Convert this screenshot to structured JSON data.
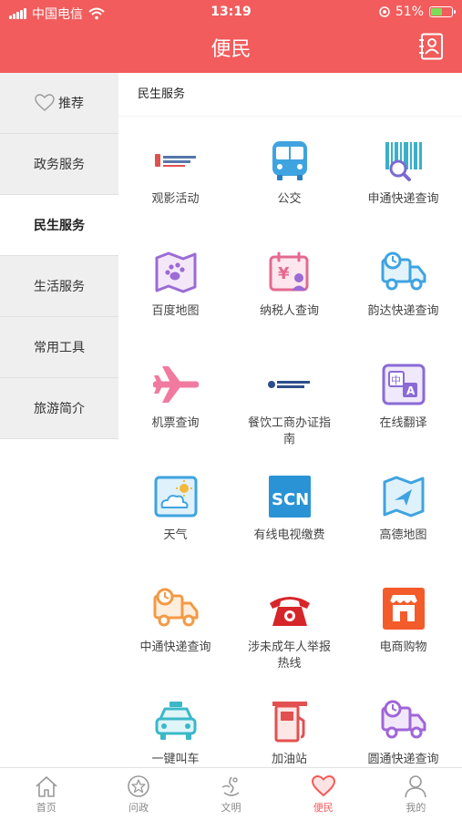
{
  "status_bar": {
    "carrier": "中国电信",
    "time": "13:19",
    "battery": "51%"
  },
  "header": {
    "title": "便民",
    "contacts_icon": "contacts-icon"
  },
  "sidebar": {
    "items": [
      {
        "label": "推荐",
        "icon": "heart-outline-icon"
      },
      {
        "label": "政务服务"
      },
      {
        "label": "民生服务",
        "active": true
      },
      {
        "label": "生活服务"
      },
      {
        "label": "常用工具"
      },
      {
        "label": "旅游简介"
      }
    ]
  },
  "main": {
    "section_title": "民生服务",
    "tiles": [
      {
        "label": "观影活动",
        "icon": "movie-logo-icon"
      },
      {
        "label": "公交",
        "icon": "bus-icon"
      },
      {
        "label": "申通快递查询",
        "icon": "barcode-search-icon"
      },
      {
        "label": "百度地图",
        "icon": "paw-map-icon"
      },
      {
        "label": "纳税人查询",
        "icon": "tax-calendar-icon"
      },
      {
        "label": "韵达快递查询",
        "icon": "delivery-truck-icon"
      },
      {
        "label": "机票查询",
        "icon": "airplane-icon"
      },
      {
        "label": "餐饮工商办证指南",
        "icon": "logo-icon"
      },
      {
        "label": "在线翻译",
        "icon": "translate-icon"
      },
      {
        "label": "天气",
        "icon": "weather-icon"
      },
      {
        "label": "有线电视缴费",
        "icon": "scn-logo-icon"
      },
      {
        "label": "高德地图",
        "icon": "map-navigation-icon"
      },
      {
        "label": "中通快递查询",
        "icon": "delivery-truck-icon"
      },
      {
        "label": "涉未成年人举报热线",
        "icon": "telephone-icon"
      },
      {
        "label": "电商购物",
        "icon": "shop-icon"
      },
      {
        "label": "一键叫车",
        "icon": "taxi-icon"
      },
      {
        "label": "加油站",
        "icon": "gas-station-icon"
      },
      {
        "label": "圆通快递查询",
        "icon": "delivery-truck-icon"
      }
    ]
  },
  "tabbar": {
    "items": [
      {
        "label": "首页",
        "icon": "home-icon"
      },
      {
        "label": "问政",
        "icon": "star-badge-icon"
      },
      {
        "label": "文明",
        "icon": "civilization-icon"
      },
      {
        "label": "便民",
        "icon": "heart-icon",
        "active": true
      },
      {
        "label": "我的",
        "icon": "user-icon"
      }
    ]
  },
  "colors": {
    "brand": "#f25c5c",
    "sidebar_bg": "#efefef",
    "text": "#333333"
  }
}
